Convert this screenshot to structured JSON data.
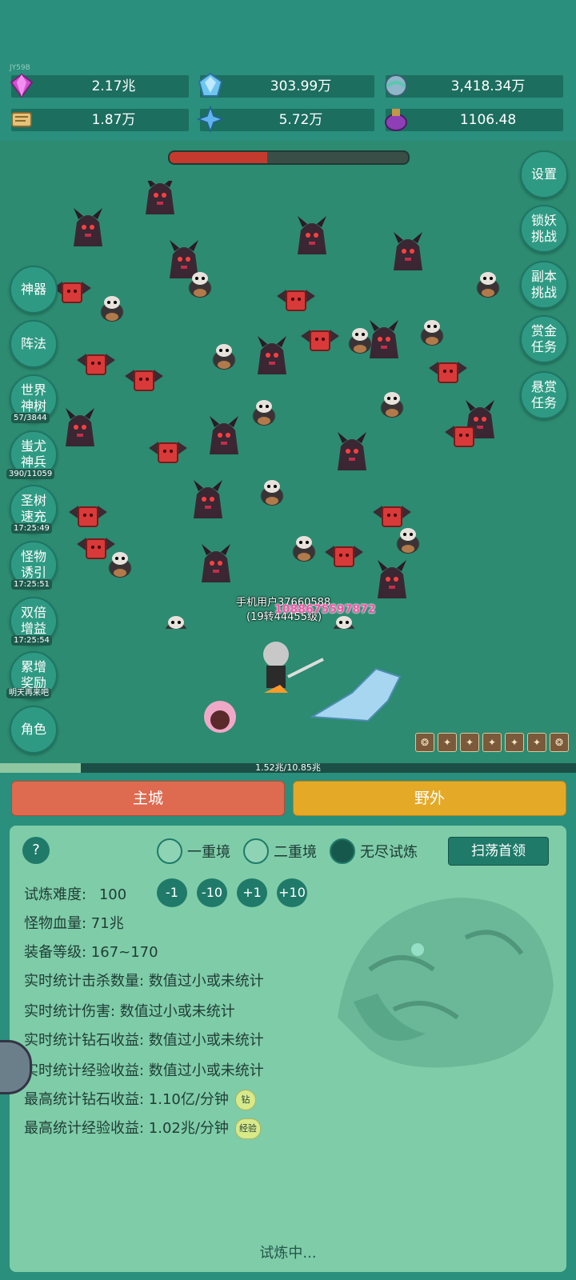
{
  "version": "JY59B",
  "resources": [
    {
      "name": "diamond-icon",
      "value": "2.17兆",
      "color": "#d34fd0"
    },
    {
      "name": "crystal-icon",
      "value": "303.99万",
      "color": "#6ec6f0"
    },
    {
      "name": "orb-icon",
      "value": "3,418.34万",
      "color": "#8fb6c9"
    },
    {
      "name": "scroll-icon",
      "value": "1.87万",
      "color": "#e5c27a"
    },
    {
      "name": "ice-shard-icon",
      "value": "5.72万",
      "color": "#5fb4ef"
    },
    {
      "name": "potion-icon",
      "value": "1106.48",
      "color": "#8e3fb5"
    }
  ],
  "boss_hp_fraction": 0.41,
  "left_buttons": [
    {
      "label": "神器"
    },
    {
      "label": "阵法"
    },
    {
      "label": "世界神树",
      "sub": "57/3844"
    },
    {
      "label": "蚩尤神兵",
      "sub": "390/11059"
    },
    {
      "label": "圣树速充",
      "sub": "17:25:49"
    },
    {
      "label": "怪物诱引",
      "sub": "17:25:51"
    },
    {
      "label": "双倍增益",
      "sub": "17:25:54"
    },
    {
      "label": "累增奖励",
      "sub": "明天再来吧"
    },
    {
      "label": "角色"
    }
  ],
  "right_buttons": [
    {
      "label": "设置"
    },
    {
      "label": "锁妖挑战"
    },
    {
      "label": "副本挑战"
    },
    {
      "label": "赏金任务"
    },
    {
      "label": "悬赏任务"
    }
  ],
  "player": {
    "name": "手机用户37660588",
    "level": "(19转44455级)",
    "damage": "1088675597872"
  },
  "exp": {
    "text": "1.52兆/10.85兆",
    "fraction": 0.14
  },
  "tabs": {
    "city": "主城",
    "wild": "野外"
  },
  "trial": {
    "help": "?",
    "modes": [
      {
        "label": "一重境",
        "selected": false
      },
      {
        "label": "二重境",
        "selected": false
      },
      {
        "label": "无尽试炼",
        "selected": true
      }
    ],
    "sweep": "扫荡首领",
    "difficulty_label": "试炼难度:",
    "difficulty_value": "100",
    "steps": [
      "-1",
      "-10",
      "+1",
      "+10"
    ],
    "rows": [
      "怪物血量: 71兆",
      "装备等级: 167~170",
      "实时统计击杀数量: 数值过小或未统计",
      "实时统计伤害: 数值过小或未统计",
      "实时统计钻石收益: 数值过小或未统计",
      "实时统计经验收益: 数值过小或未统计"
    ],
    "best_diamond": "最高统计钻石收益: 1.10亿/分钟",
    "best_diamond_tag": "钻",
    "best_exp": "最高统计经验收益: 1.02兆/分钟",
    "best_exp_tag": "经验",
    "status": "试炼中..."
  }
}
